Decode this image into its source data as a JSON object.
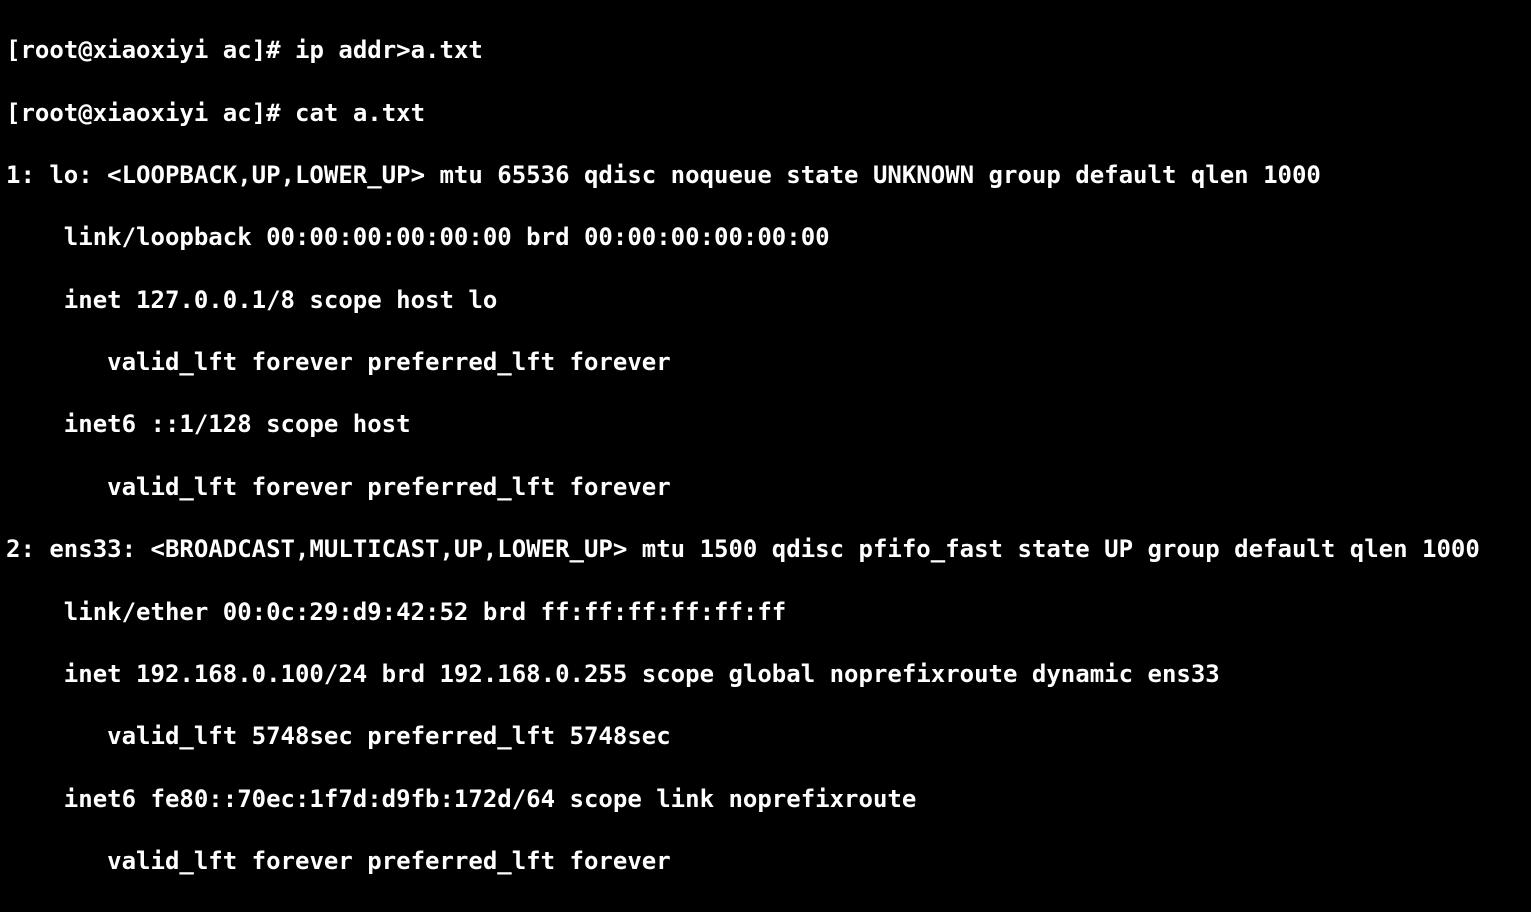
{
  "terminal": {
    "prompt_user": "root",
    "prompt_host": "xiaoxiyi",
    "prompt_dir": "ac",
    "prompt_suffix": "#",
    "commands": [
      {
        "input": "ip addr>a.txt"
      },
      {
        "input": "cat a.txt"
      }
    ],
    "output_lines": [
      "1: lo: <LOOPBACK,UP,LOWER_UP> mtu 65536 qdisc noqueue state UNKNOWN group default qlen 1000",
      "    link/loopback 00:00:00:00:00:00 brd 00:00:00:00:00:00",
      "    inet 127.0.0.1/8 scope host lo",
      "       valid_lft forever preferred_lft forever",
      "    inet6 ::1/128 scope host ",
      "       valid_lft forever preferred_lft forever",
      "2: ens33: <BROADCAST,MULTICAST,UP,LOWER_UP> mtu 1500 qdisc pfifo_fast state UP group default qlen 1000",
      "    link/ether 00:0c:29:d9:42:52 brd ff:ff:ff:ff:ff:ff",
      "    inet 192.168.0.100/24 brd 192.168.0.255 scope global noprefixroute dynamic ens33",
      "       valid_lft 5748sec preferred_lft 5748sec",
      "    inet6 fe80::70ec:1f7d:d9fb:172d/64 scope link noprefixroute ",
      "       valid_lft forever preferred_lft forever"
    ]
  },
  "ip_addr_data": {
    "interfaces": [
      {
        "index": 1,
        "name": "lo",
        "flags": [
          "LOOPBACK",
          "UP",
          "LOWER_UP"
        ],
        "mtu": 65536,
        "qdisc": "noqueue",
        "state": "UNKNOWN",
        "group": "default",
        "qlen": 1000,
        "link_type": "loopback",
        "link_addr": "00:00:00:00:00:00",
        "link_brd": "00:00:00:00:00:00",
        "inet": {
          "addr": "127.0.0.1/8",
          "scope": "host",
          "dev": "lo",
          "valid_lft": "forever",
          "preferred_lft": "forever"
        },
        "inet6": {
          "addr": "::1/128",
          "scope": "host",
          "valid_lft": "forever",
          "preferred_lft": "forever"
        }
      },
      {
        "index": 2,
        "name": "ens33",
        "flags": [
          "BROADCAST",
          "MULTICAST",
          "UP",
          "LOWER_UP"
        ],
        "mtu": 1500,
        "qdisc": "pfifo_fast",
        "state": "UP",
        "group": "default",
        "qlen": 1000,
        "link_type": "ether",
        "link_addr": "00:0c:29:d9:42:52",
        "link_brd": "ff:ff:ff:ff:ff:ff",
        "inet": {
          "addr": "192.168.0.100/24",
          "brd": "192.168.0.255",
          "scope": "global",
          "flags": "noprefixroute dynamic",
          "dev": "ens33",
          "valid_lft": "5748sec",
          "preferred_lft": "5748sec"
        },
        "inet6": {
          "addr": "fe80::70ec:1f7d:d9fb:172d/64",
          "scope": "link",
          "flags": "noprefixroute",
          "valid_lft": "forever",
          "preferred_lft": "forever"
        }
      }
    ]
  }
}
